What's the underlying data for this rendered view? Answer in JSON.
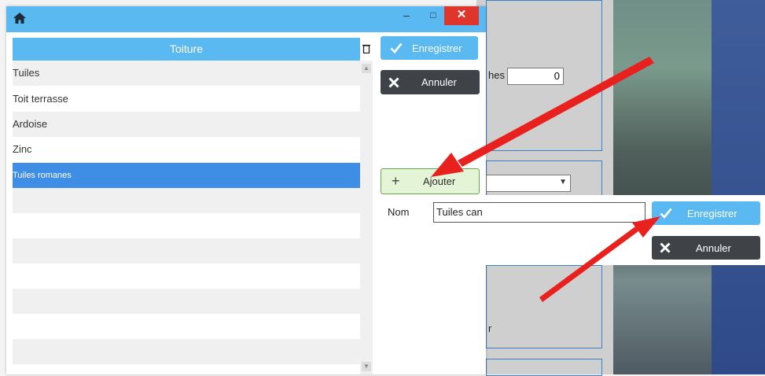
{
  "background": {
    "field_value": "0",
    "field_label_partial": "hes",
    "bottom_label_partial": "r"
  },
  "dialog": {
    "title_icon": "home-icon",
    "minimize_label": "–",
    "maximize_label": "□",
    "close_label": "✕"
  },
  "list": {
    "header": "Toiture",
    "header_icon": "delete-icon",
    "items": [
      {
        "label": "Tuiles"
      },
      {
        "label": "Toit terrasse"
      },
      {
        "label": "Ardoise"
      },
      {
        "label": "Zinc"
      },
      {
        "label": "Tuiles romanes"
      }
    ],
    "selected_index": 4
  },
  "actions": {
    "save_label": "Enregistrer",
    "cancel_label": "Annuler",
    "add_label": "Ajouter"
  },
  "edit_panel": {
    "nom_label": "Nom",
    "nom_value": "Tuiles can",
    "save_label": "Enregistrer",
    "cancel_label": "Annuler"
  },
  "colors": {
    "titlebar": "#5bb9f2",
    "selected_row": "#3d8ee4",
    "cancel_button": "#3f4247",
    "add_button_bg": "#e3f5d6",
    "close_button": "#e0352b",
    "annotation_arrow": "#e8211f"
  }
}
